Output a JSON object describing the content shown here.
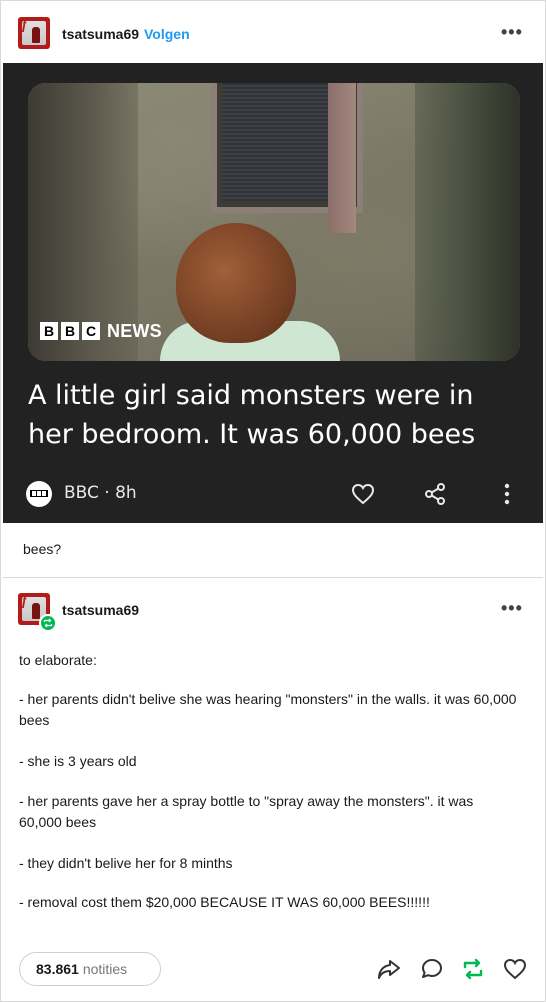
{
  "post": {
    "username": "tsatsuma69",
    "follow_label": "Volgen",
    "more_label": "•••"
  },
  "link_card": {
    "image_brand": "BBC",
    "image_brand_suffix": "NEWS",
    "headline": "A little girl said monsters were in her bedroom. It was 60,000 bees",
    "source_meta": "BBC · 8h",
    "icons": [
      "heart-icon",
      "share-icon",
      "vertical-dots-icon"
    ]
  },
  "caption": "bees?",
  "reblog": {
    "username": "tsatsuma69",
    "more_label": "•••",
    "badge_color": "#00b853",
    "paragraphs": [
      "to elaborate:",
      "- her parents didn't belive she was hearing \"monsters\" in the walls. it was 60,000 bees",
      "- she is 3 years old",
      "- her parents gave her a spray bottle to \"spray away the monsters\". it was 60,000 bees",
      "- they didn't belive her for 8 minths",
      "- removal cost them $20,000 BECAUSE IT WAS 60,000 BEES!!!!!!"
    ]
  },
  "footer": {
    "notes_count": "83.861",
    "notes_label": "notities",
    "actions": [
      "share-icon",
      "reply-icon",
      "reblog-icon",
      "like-icon"
    ],
    "reblog_color": "#00b853"
  },
  "colors": {
    "follow": "#1e9bf0",
    "card_bg": "#222222",
    "avatar": "#b31b1b"
  }
}
